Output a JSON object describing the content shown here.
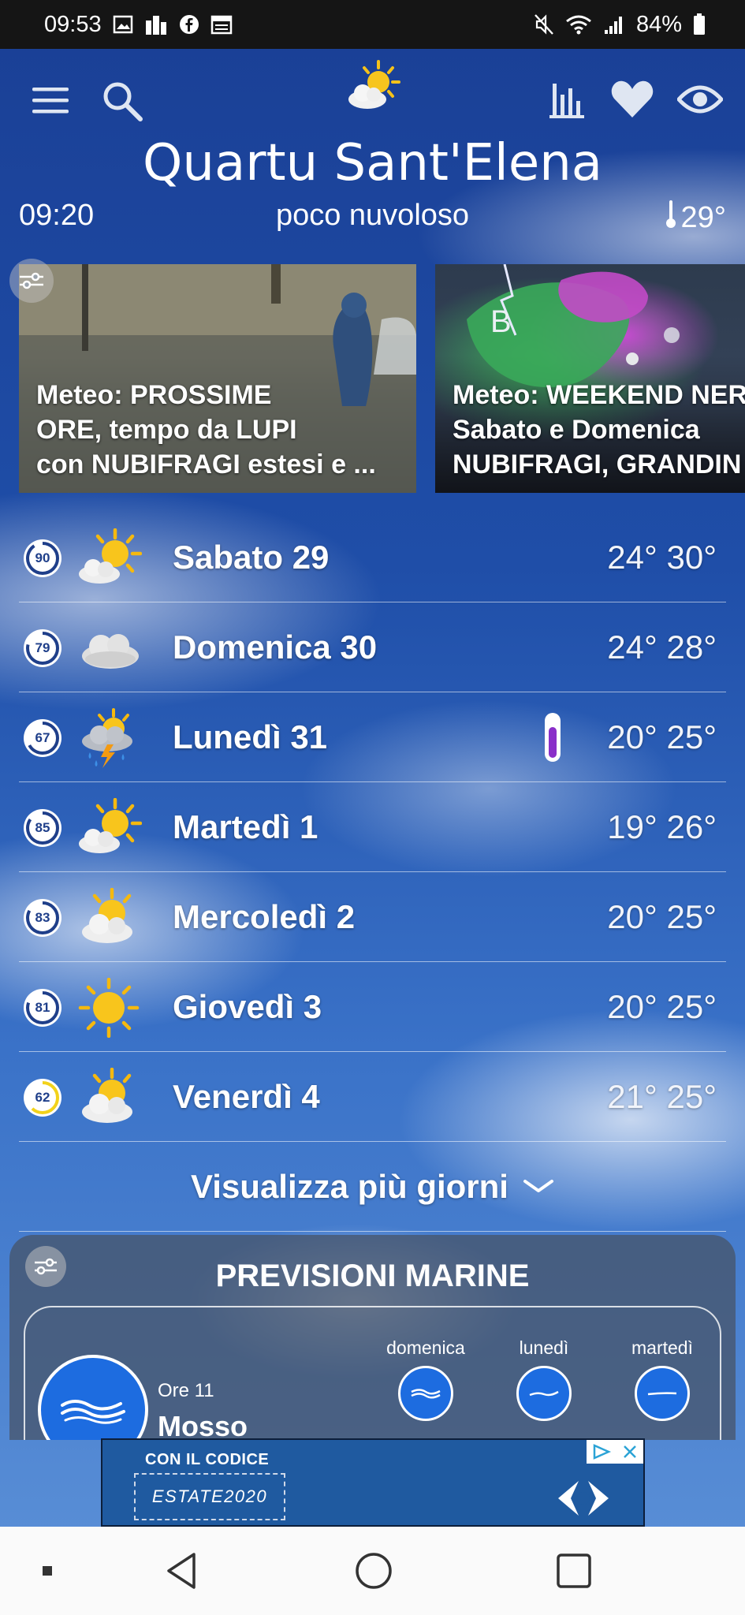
{
  "status_bar": {
    "time": "09:53",
    "battery": "84%"
  },
  "header": {
    "city": "Quartu Sant'Elena",
    "time": "09:20",
    "condition": "poco nuvoloso",
    "temperature": "29°"
  },
  "news": [
    {
      "title": "Meteo: PROSSIME\nORE, tempo da LUPI\ncon NUBIFRAGI estesi e ..."
    },
    {
      "title": "Meteo: WEEKEND NER\nSabato e Domenica\nNUBIFRAGI, GRANDIN"
    }
  ],
  "news_card2_map_letter": "B",
  "forecast": [
    {
      "score": "90",
      "day": "Sabato 29",
      "temps": "24° 30°",
      "icon": "sun-cloud-icon"
    },
    {
      "score": "79",
      "day": "Domenica 30",
      "temps": "24° 28°",
      "icon": "cloud-icon"
    },
    {
      "score": "67",
      "day": "Lunedì 31",
      "temps": "20° 25°",
      "icon": "storm-icon"
    },
    {
      "score": "85",
      "day": "Martedì 1",
      "temps": "19° 26°",
      "icon": "sun-cloud-icon"
    },
    {
      "score": "83",
      "day": "Mercoledì 2",
      "temps": "20° 25°",
      "icon": "sun-cloud-icon"
    },
    {
      "score": "81",
      "day": "Giovedì 3",
      "temps": "20° 25°",
      "icon": "sun-icon"
    },
    {
      "score": "62",
      "day": "Venerdì 4",
      "temps": "21° 25°",
      "icon": "sun-cloud-icon"
    }
  ],
  "more_days_label": "Visualizza più giorni",
  "marine": {
    "title": "PREVISIONI MARINE",
    "ore": "Ore 11",
    "state": "Mosso",
    "days": [
      "domenica",
      "lunedì",
      "martedì"
    ]
  },
  "ad": {
    "line1": "CON IL CODICE",
    "code": "ESTATE2020"
  },
  "colors": {
    "score_ring": "#ffffff",
    "score_ring_low": "#f2d21b",
    "accent_blue": "#1d6ce0",
    "thermo_purple": "#8a2fc9"
  }
}
